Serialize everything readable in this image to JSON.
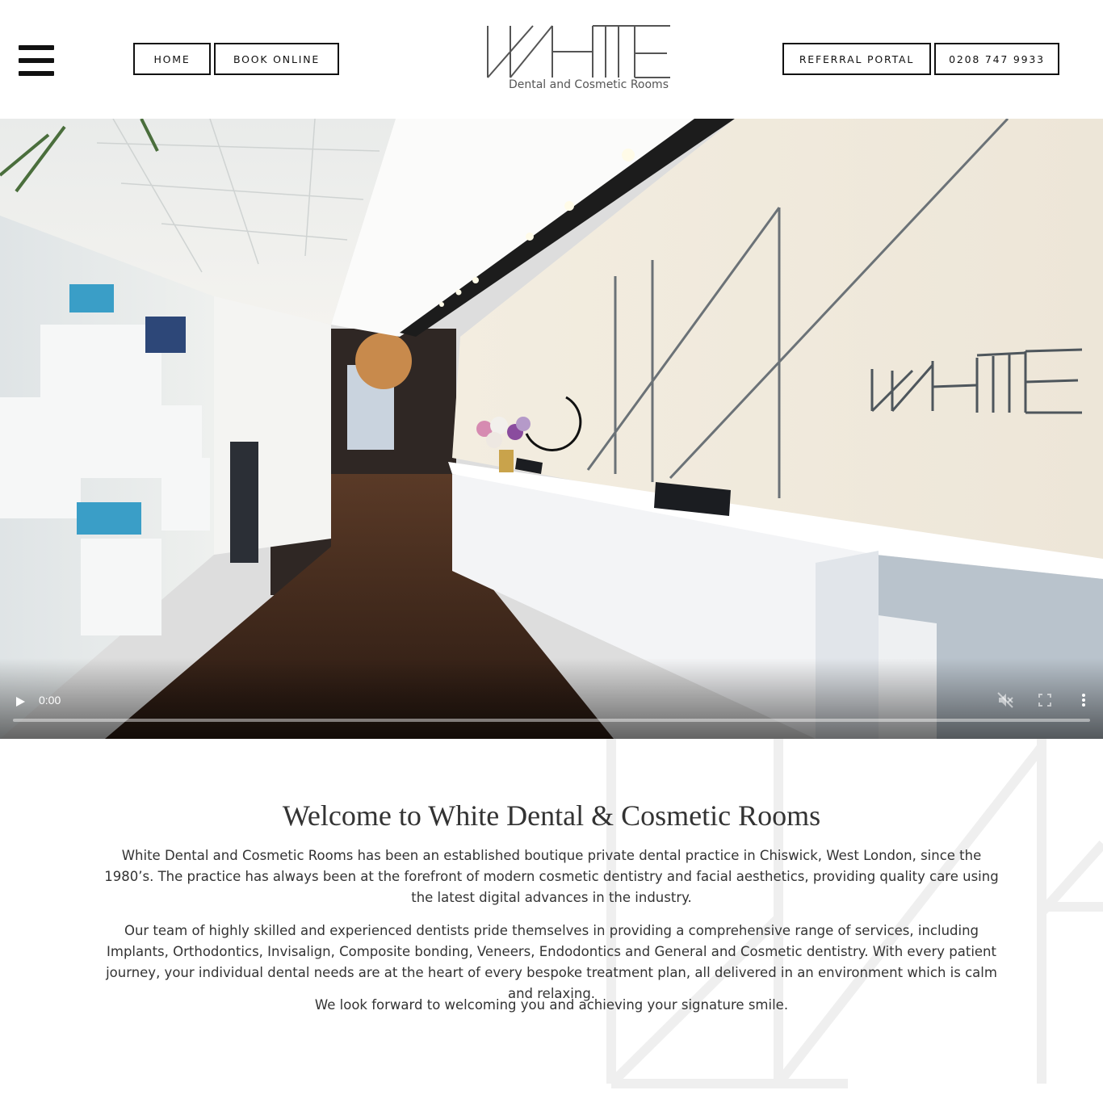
{
  "header": {
    "menu_icon": "hamburger-menu-icon",
    "nav_left": [
      {
        "label": "HOME"
      },
      {
        "label": "BOOK ONLINE"
      }
    ],
    "nav_right": [
      {
        "label": "REFERRAL PORTAL"
      },
      {
        "label": "0208 747 9933"
      }
    ],
    "logo": {
      "wordmark": "WHITE",
      "subtitle": "Dental and Cosmetic Rooms"
    }
  },
  "video": {
    "time": "0:00",
    "progress": 0,
    "icons": [
      "play-icon",
      "muted-volume-icon",
      "fullscreen-icon",
      "more-options-icon"
    ],
    "scene_sign": "WHITE"
  },
  "welcome": {
    "title": "Welcome to White Dental & Cosmetic Rooms",
    "paragraphs": [
      "White Dental and Cosmetic Rooms has been an established boutique private dental practice in Chiswick, West London, since the 1980’s. The practice has always been at the forefront of modern cosmetic dentistry and facial aesthetics, providing quality care using the latest digital advances in the industry.",
      "Our team of highly skilled and experienced dentists pride themselves in providing a comprehensive range of services, including Implants, Orthodontics, Invisalign, Composite bonding, Veneers, Endodontics and General and Cosmetic dentistry. With every patient journey, your individual dental needs are at the heart of every bespoke treatment plan, all delivered in an environment which is calm and relaxing.",
      "We look forward to welcoming you and achieving your signature smile."
    ]
  },
  "colors": {
    "text": "#333333",
    "button_border": "#111111",
    "logo_line": "#555555",
    "watermark": "#efefef"
  }
}
